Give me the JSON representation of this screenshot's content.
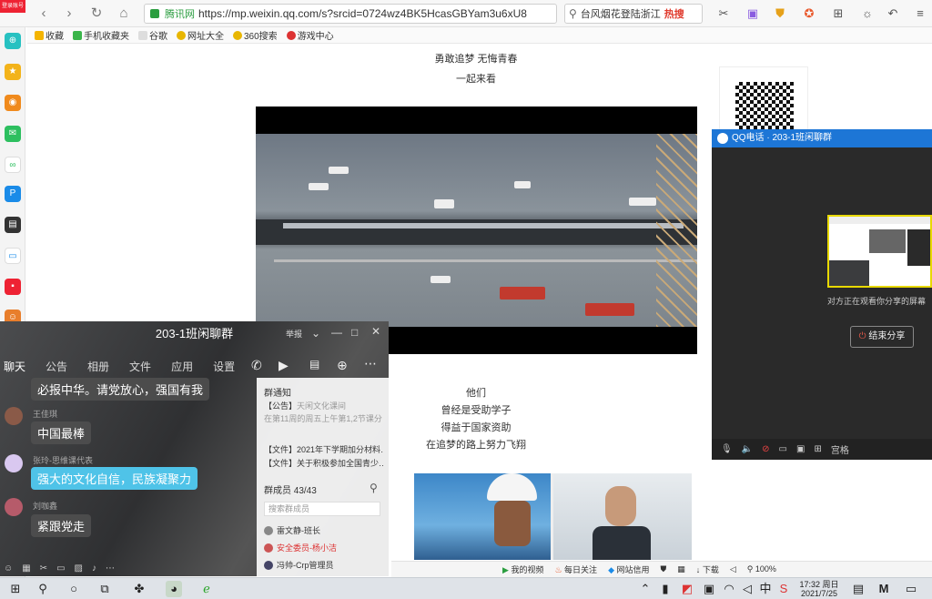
{
  "browser": {
    "site_name": "腾讯网",
    "url": "https://mp.weixin.qq.com/s?srcid=0724wz4BK5HcasGBYam3u6xU8",
    "search_query": "台风烟花登陆浙江",
    "search_hot": "热搜",
    "bookmarks": [
      "收藏",
      "手机收藏夹",
      "谷歌",
      "网址大全",
      "360搜索",
      "游戏中心"
    ],
    "sidebar_badge": "登录账号"
  },
  "article": {
    "line1": "勇敢追梦  无悔青春",
    "line2": "一起来看",
    "line3": "他们",
    "line4": "曾经是受助学子",
    "line5": "得益于国家资助",
    "line6": "在追梦的路上努力飞翔"
  },
  "qq_call": {
    "title": "QQ电话 · 203-1班闲聊群",
    "sharing_note": "对方正在观看你分享的屏幕",
    "end_share_label": "结束分享",
    "grid_label": "宫格"
  },
  "group_chat": {
    "title": "203-1班闲聊群",
    "report_label": "举报",
    "tabs": [
      "聊天",
      "公告",
      "相册",
      "文件",
      "应用",
      "设置"
    ],
    "messages": [
      {
        "sender": "",
        "text": "必报中华。请党放心，强国有我"
      },
      {
        "sender": "王佳琪",
        "text": "中国最棒"
      },
      {
        "sender": "张玲-思维课代表",
        "text": "强大的文化自信，民族凝聚力"
      },
      {
        "sender": "刘咖鑫",
        "text": "紧跟党走"
      }
    ],
    "notice_title": "群通知",
    "notice_line": "【公告】",
    "notice_faded1": "天闲文化课间",
    "notice_faded2": "在第11周的周五上午第1,2节课分",
    "file1": "【文件】2021年下学期加分材料…",
    "file2": "【文件】关于积极参加全国青少…",
    "members_label": "群成员 43/43",
    "member_search_placeholder": "搜索群成员",
    "members": [
      "雷文静-班长",
      "安全委员-杨小洁",
      "冯帅-Crp管理员"
    ]
  },
  "status_bar": {
    "items": [
      "我的视频",
      "每日关注",
      "网站信用",
      "下载",
      "100%"
    ]
  },
  "taskbar": {
    "time": "17:32 周日",
    "date": "2021/7/25",
    "ime": "M"
  },
  "colors": {
    "accent_blue": "#1d76d6",
    "chat_highlight": "#4fc3e8",
    "hot_red": "#e03b2e"
  }
}
